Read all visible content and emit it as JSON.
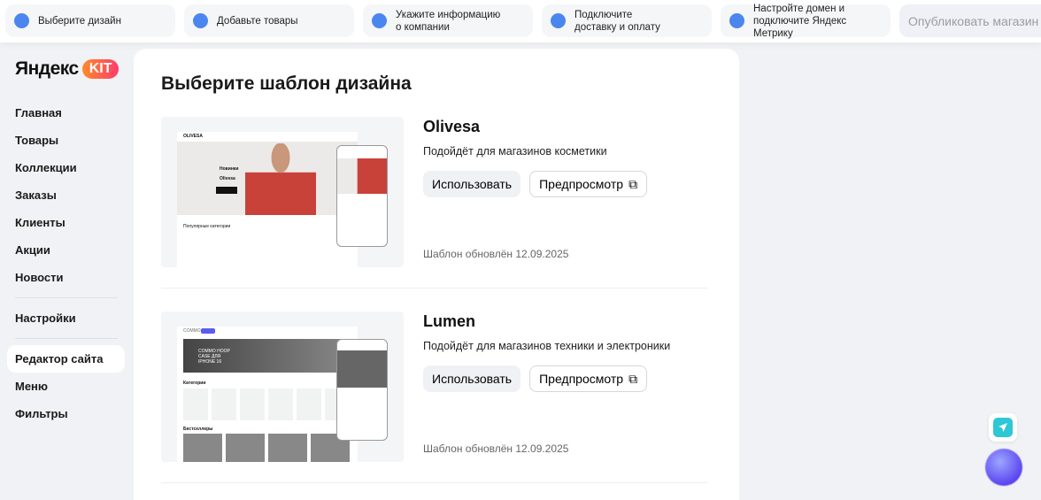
{
  "steps": [
    {
      "label": "Выберите дизайн"
    },
    {
      "label": "Добавьте товары"
    },
    {
      "label": "Укажите информацию о компании"
    },
    {
      "label": "Подключите доставку и оплату"
    },
    {
      "label": "Настройте домен и подключите Яндекс Метрику"
    }
  ],
  "publish_label": "Опубликовать магазин",
  "logo": {
    "brand": "Яндекс",
    "product": "KIT"
  },
  "nav": {
    "items": [
      "Главная",
      "Товары",
      "Коллекции",
      "Заказы",
      "Клиенты",
      "Акции",
      "Новости"
    ],
    "settings": "Настройки",
    "editor": "Редактор сайта",
    "menu": "Меню",
    "filters": "Фильтры"
  },
  "page_title": "Выберите шаблон дизайна",
  "templates": [
    {
      "name": "Olivesa",
      "desc": "Подойдёт для магазинов косметики",
      "use": "Использовать",
      "preview": "Предпросмотр",
      "updated": "Шаблон обновлён 12.09.2025",
      "thumb": {
        "brand": "OLIVESA",
        "hero1": "Новинки",
        "hero2": "Olivesa",
        "section": "Популярные категории"
      }
    },
    {
      "name": "Lumen",
      "desc": "Подойдёт для магазинов техники и электроники",
      "use": "Использовать",
      "preview": "Предпросмотр",
      "updated": "Шаблон обновлён 12.09.2025",
      "thumb": {
        "brand": "COMMO",
        "hero": "COMMO HOOP CASE ДЛЯ IPHONE 16",
        "section": "Категории",
        "section2": "Бестселлеры"
      }
    }
  ],
  "colors": {
    "step_dot": "#4b86ef",
    "accent": "#ff5a4a"
  }
}
